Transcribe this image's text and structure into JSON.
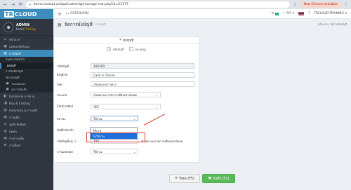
{
  "browser": {
    "url": "demo.trcloud.co/application/gl/manage-coa.php?id=21177",
    "chrome_notice": "New Chrome available"
  },
  "sidebar": {
    "brand_prefix": "TR",
    "brand_suffix": "CLOUD",
    "user_name": "ADMIN",
    "user_home": "Home",
    "user_status": "Trading",
    "menu": [
      {
        "label": "หน้าแรก"
      },
      {
        "label": "แดชบอร์ดข้อมูล"
      },
      {
        "label": "การบัญชี",
        "active": true
      }
    ],
    "submenu": [
      {
        "label": "สมุดรายวันทั่วไป"
      },
      {
        "label": "ผังบัญชี",
        "current": true
      },
      {
        "label": "การบันทึกบัญชี"
      },
      {
        "label": "ปิดงวดบัญชี"
      },
      {
        "label": "Translation"
      },
      {
        "label": "งบการเงินเต็ม"
      }
    ],
    "menu_bottom": [
      {
        "label": "Income & การขาย"
      },
      {
        "label": "Buy & Costing"
      },
      {
        "label": "Inventory & การคลัง"
      },
      {
        "label": "การผลิต"
      },
      {
        "label": "ลูกค้าสัมพันธ์"
      },
      {
        "label": "บุคคล"
      },
      {
        "label": "รายงานเพิ่ม"
      },
      {
        "label": "การตั้งค่า"
      }
    ]
  },
  "topbar": {
    "extension_label": "EXTENSION",
    "msg_count": "1",
    "api_label": "API",
    "company": "TRCLOUD-TRAINING"
  },
  "page": {
    "title": "จัดการผังบัญชี",
    "subtitle": "การบัญชี",
    "breadcrumb": "หน้าแรก / จัดการผังบัญชี"
  },
  "form": {
    "header": "ผังบัญชี",
    "radio_1": "รหัสบัญชี",
    "radio_2": "หมวดหมู่",
    "fields": {
      "code": {
        "label": "รหัสบัญชี",
        "value": "100100"
      },
      "english": {
        "label": "English",
        "value": "Cash in Transit"
      },
      "thai": {
        "label": "ไทย",
        "value": "เงินสดระหว่างทาง"
      },
      "type": {
        "label": "ประเภท",
        "value": "เงินสด และรายการเทียบเท่าเงินสด"
      },
      "eliminated": {
        "label": "Eliminated",
        "value": "YES"
      },
      "status": {
        "label": "สถานะ",
        "value": "ใช้งาน"
      },
      "remark": {
        "label": "บันทึกช่วยจำ"
      },
      "parent": {
        "label": "รหัสบัญชีแม่",
        "value": "100",
        "hint": "เงินสด และรายการเทียบเท่าเงินสด"
      },
      "display": {
        "label": "การแสดงผล",
        "value": "ใช้งาน"
      }
    },
    "status_options": [
      {
        "label": "ใช้งาน"
      },
      {
        "label": "ไม่ใช้งาน",
        "highlighted": true
      }
    ]
  },
  "buttons": {
    "reset": "รีเซต (F5)",
    "save": "บันทึก (F2)"
  }
}
